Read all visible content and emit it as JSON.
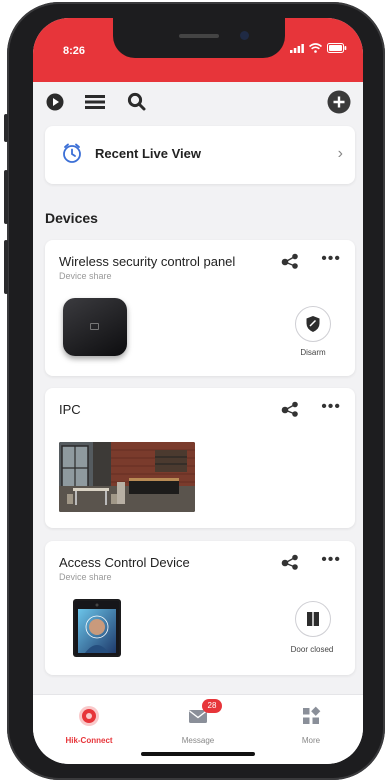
{
  "status": {
    "time": "8:26"
  },
  "recent": {
    "label": "Recent Live View"
  },
  "section": {
    "devices_title": "Devices"
  },
  "devices": [
    {
      "name": "Wireless security control panel",
      "subtitle": "Device share",
      "action_label": "Disarm",
      "action_icon": "shield-icon",
      "thumbnail": "control-panel-image"
    },
    {
      "name": "IPC",
      "subtitle": "",
      "thumbnail": "camera-live-image"
    },
    {
      "name": "Access Control Device",
      "subtitle": "Device share",
      "action_label": "Door closed",
      "action_icon": "door-icon",
      "thumbnail": "access-terminal-image"
    }
  ],
  "tabs": [
    {
      "label": "Hik-Connect",
      "icon": "hik-connect-icon",
      "active": true
    },
    {
      "label": "Message",
      "icon": "mail-icon",
      "badge": "28"
    },
    {
      "label": "More",
      "icon": "grid-icon"
    }
  ],
  "colors": {
    "accent": "#e7353a",
    "background": "#f2f2f4",
    "card": "#ffffff"
  }
}
